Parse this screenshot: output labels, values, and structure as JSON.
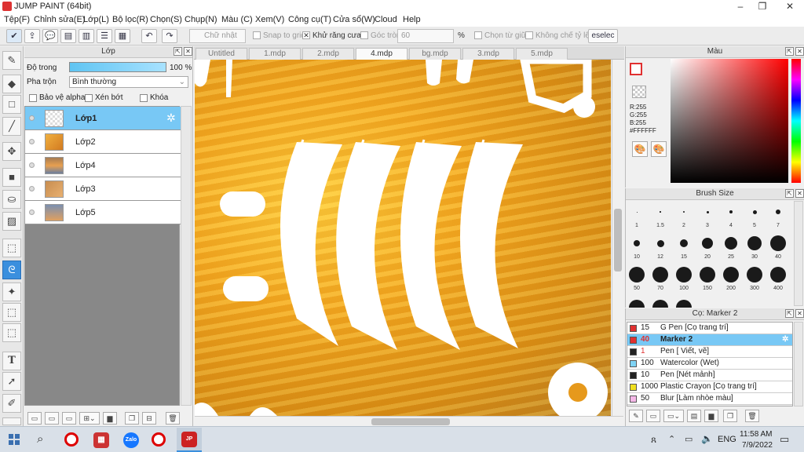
{
  "window": {
    "title": "JUMP PAINT (64bit)",
    "controls": [
      "–",
      "❐",
      "✕"
    ]
  },
  "menu": [
    "Tệp(F)",
    "Chỉnh sửa(E)",
    "Lớp(L)",
    "Bộ lọc(R)",
    "Chọn(S)",
    "Chụp(N)",
    "Màu (C)",
    "Xem(V)",
    "Công cụ(T)",
    "Cửa sổ(W)",
    "Cloud",
    "Help"
  ],
  "toolbar": {
    "shape_select": "Chữ nhật",
    "snap_label": "Snap to grid",
    "antialias_label": "Khử răng cưa",
    "corner_label": "Góc tròn",
    "corner_value": "60",
    "corner_unit": "%",
    "center_label": "Chọn từ giữa",
    "ratio_label": "Không chế tỷ lệ",
    "deselect_label": "eselec"
  },
  "layers_panel": {
    "title": "Lớp",
    "opacity_label": "Độ trong",
    "opacity_value": "100 %",
    "opacity_fraction": 1.0,
    "blend_label": "Pha trộn",
    "blend_value": "Bình thường",
    "protect_alpha": "Bảo vệ alpha",
    "clipping": "Xén bớt",
    "lock": "Khóa",
    "layers": [
      {
        "name": "Lớp1",
        "selected": true
      },
      {
        "name": "Lớp2",
        "selected": false
      },
      {
        "name": "Lớp4",
        "selected": false
      },
      {
        "name": "Lớp3",
        "selected": false
      },
      {
        "name": "Lớp5",
        "selected": false
      }
    ]
  },
  "tabs": [
    "Untitled",
    "1.mdp",
    "2.mdp",
    "4.mdp",
    "bg.mdp",
    "3.mdp",
    "5.mdp"
  ],
  "active_tab": "4.mdp",
  "color_panel": {
    "title": "Màu",
    "r": "R:255",
    "g": "G:255",
    "b": "B:255",
    "hex": "#FFFFFF"
  },
  "brush_size_panel": {
    "title": "Brush Size",
    "sizes": [
      "1",
      "1.5",
      "2",
      "3",
      "4",
      "5",
      "7",
      "10",
      "12",
      "15",
      "20",
      "25",
      "30",
      "40",
      "50",
      "70",
      "100",
      "150",
      "200",
      "300",
      "400"
    ]
  },
  "subtool_panel": {
    "title": "Cọ: Marker 2",
    "items": [
      {
        "size": "15",
        "name": "G Pen [Cọ trang trí]",
        "color": "#e03030",
        "selected": false
      },
      {
        "size": "40",
        "name": "Marker 2",
        "color": "#e03030",
        "selected": true
      },
      {
        "size": "1",
        "name": "Pen [ Viết, vẽ]",
        "color": "#222222",
        "selected": false
      },
      {
        "size": "100",
        "name": "Watercolor (Wet)",
        "color": "#7fd3f5",
        "selected": false
      },
      {
        "size": "10",
        "name": "Pen [Nét mảnh]",
        "color": "#222222",
        "selected": false
      },
      {
        "size": "1000",
        "name": "Plastic Crayon [Cọ trang trí]",
        "color": "#f0e020",
        "selected": false
      },
      {
        "size": "50",
        "name": "Blur [Làm nhòe màu]",
        "color": "#f5b8e8",
        "selected": false
      }
    ]
  },
  "taskbar": {
    "time": "11:58 AM",
    "date": "7/9/2022",
    "lang": "ENG"
  }
}
